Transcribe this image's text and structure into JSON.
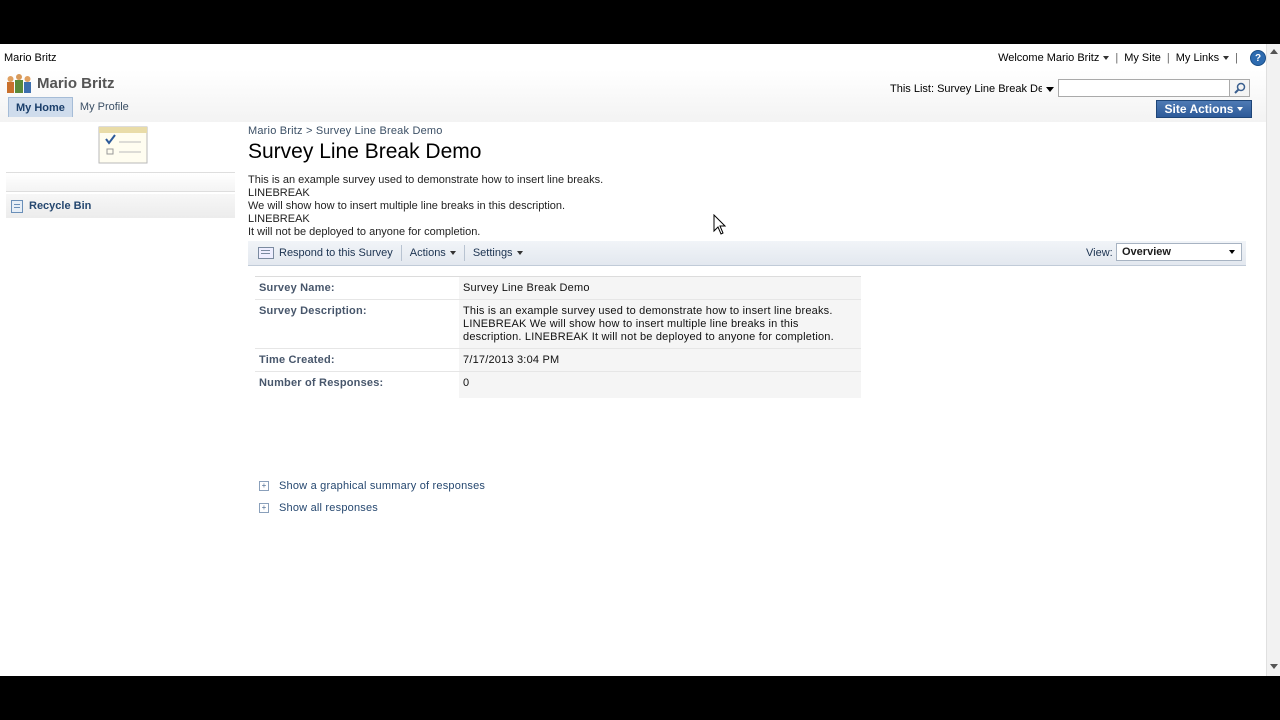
{
  "topbar": {
    "site_name": "Mario Britz",
    "welcome": "Welcome Mario Britz",
    "my_site": "My Site",
    "my_links": "My Links",
    "separator": "|",
    "help_icon": "help-icon"
  },
  "header": {
    "title": "Mario Britz",
    "tabs": [
      {
        "label": "My Home",
        "selected": true
      },
      {
        "label": "My Profile",
        "selected": false
      }
    ],
    "search_scope": "This List: Survey Line Break De",
    "search_placeholder": "",
    "site_actions": "Site Actions"
  },
  "leftnav": {
    "items": [
      {
        "label": "Recycle Bin",
        "icon": "recycle-bin-icon"
      }
    ]
  },
  "main": {
    "breadcrumb": {
      "root": "Mario Britz",
      "separator": ">",
      "current": "Survey Line Break Demo"
    },
    "title": "Survey Line Break Demo",
    "description_lines": [
      "This is an example survey used to demonstrate how to insert line breaks.",
      "LINEBREAK",
      "We will show how to insert multiple line breaks in this description.",
      "LINEBREAK",
      "It will not be deployed to anyone for completion."
    ],
    "toolbar": {
      "respond": "Respond to this Survey",
      "actions": "Actions",
      "settings": "Settings",
      "view_label": "View:",
      "view_value": "Overview"
    },
    "properties": [
      {
        "label": "Survey Name:",
        "value": "Survey Line Break Demo"
      },
      {
        "label": "Survey Description:",
        "value": "This is an example survey used to demonstrate how to insert line breaks. LINEBREAK We will show how to insert multiple line breaks in this description. LINEBREAK It will not be deployed to anyone for completion."
      },
      {
        "label": "Time Created:",
        "value": "7/17/2013 3:04 PM"
      },
      {
        "label": "Number of Responses:",
        "value": "0"
      }
    ],
    "links": [
      "Show a graphical summary of responses",
      "Show all responses"
    ]
  },
  "colors": {
    "accent": "#2d5a99",
    "tab_selected": "#cfdcec",
    "link": "#264870"
  }
}
